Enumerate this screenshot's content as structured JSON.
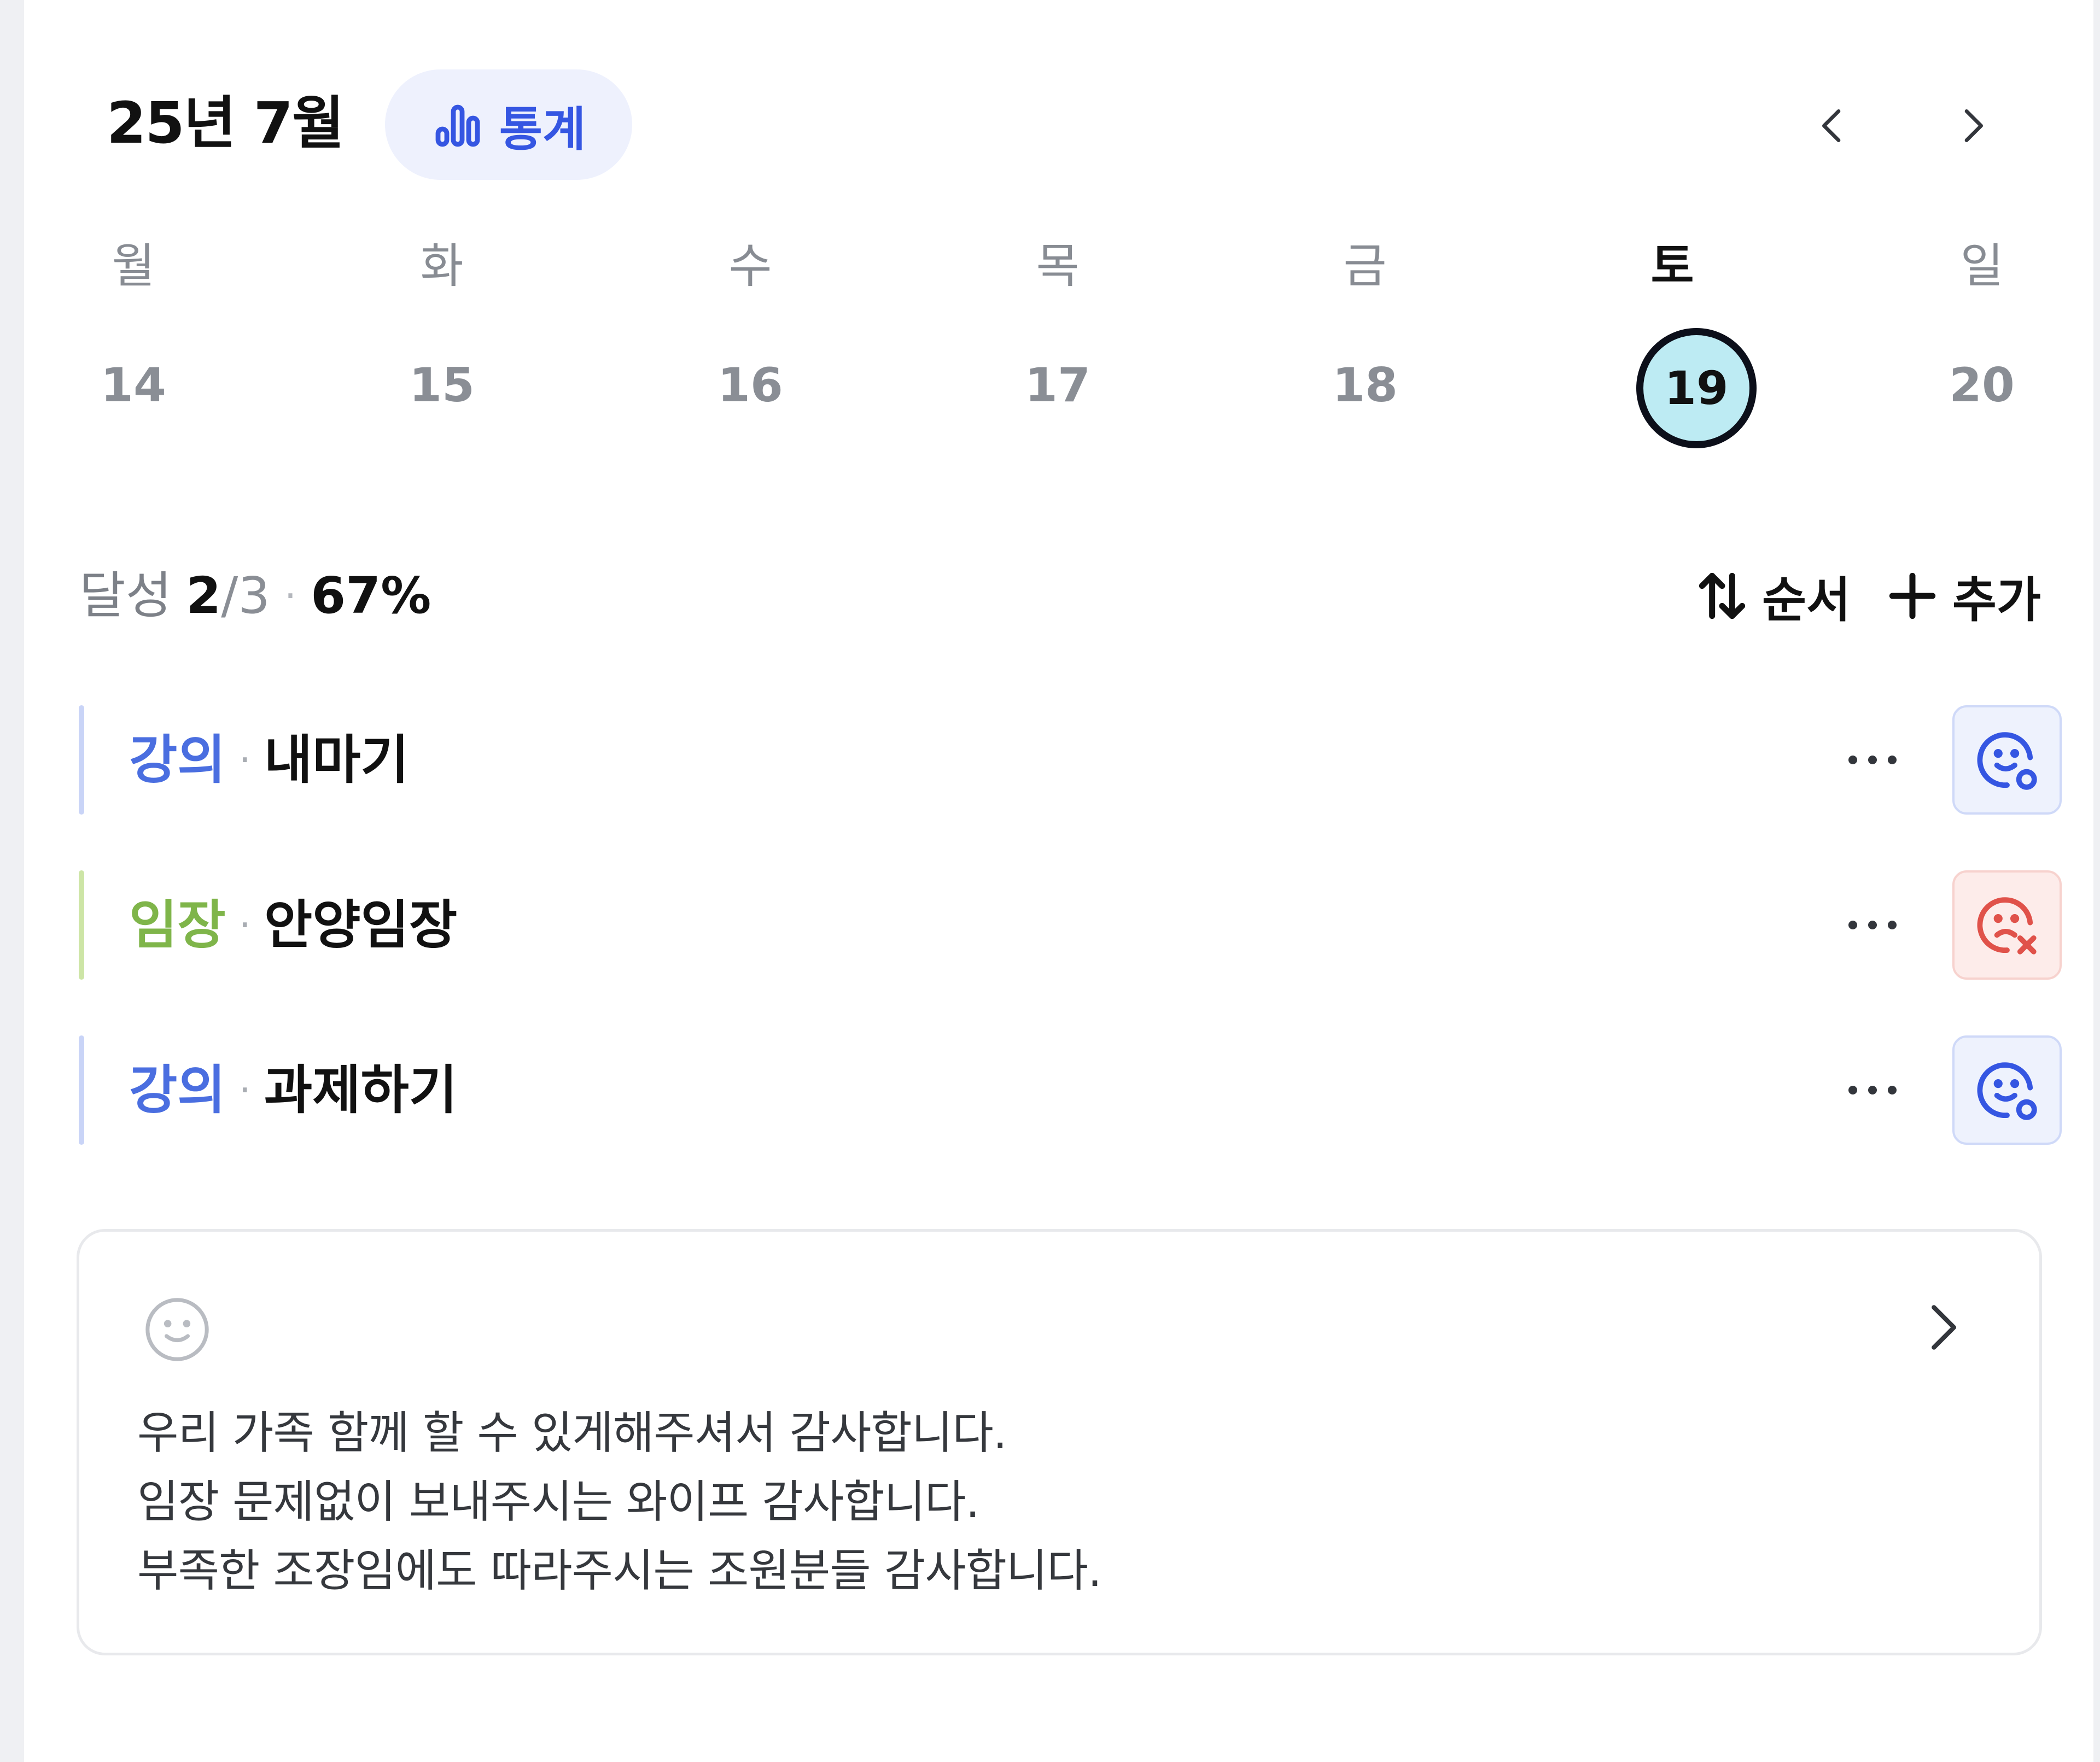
{
  "header": {
    "month_title": "25년 7월",
    "stats_label": "통계",
    "prev_icon": "chevron-left-icon",
    "next_icon": "chevron-right-icon"
  },
  "week": {
    "days": [
      {
        "weekday": "월",
        "date": "14"
      },
      {
        "weekday": "화",
        "date": "15"
      },
      {
        "weekday": "수",
        "date": "16"
      },
      {
        "weekday": "목",
        "date": "17"
      },
      {
        "weekday": "금",
        "date": "18"
      },
      {
        "weekday": "토",
        "date": "19",
        "selected": true
      },
      {
        "weekday": "일",
        "date": "20"
      }
    ]
  },
  "summary": {
    "label": "달성",
    "done": "2",
    "total": "/3",
    "dot": "·",
    "percent": "67%",
    "sort_label": "순서",
    "add_label": "추가"
  },
  "tasks": [
    {
      "category": "강의",
      "sep": "·",
      "title": "내마기",
      "status": "success",
      "category_color": "#4a6ee0",
      "bar_color": "#c9d4f7"
    },
    {
      "category": "임장",
      "sep": "·",
      "title": "안양임장",
      "status": "failed",
      "category_color": "#7fb54a",
      "bar_color": "#cde5a6"
    },
    {
      "category": "강의",
      "sep": "·",
      "title": "과제하기",
      "status": "success",
      "category_color": "#4a6ee0",
      "bar_color": "#c9d4f7"
    }
  ],
  "note": {
    "mood_icon": "smiley-icon",
    "lines": [
      "우리 가족 함께 할 수 있게해주셔서 감사합니다.",
      "임장 문제없이 보내주시는 와이프 감사합니다.",
      "부족한 조장임에도 따라주시는 조원분들 감사합니다."
    ]
  },
  "colors": {
    "accent": "#3556e2",
    "selected_day_fill": "#bdebf3",
    "success_bg": "#eef2fd",
    "failed_bg": "#fdecea",
    "failed": "#e0524a"
  }
}
